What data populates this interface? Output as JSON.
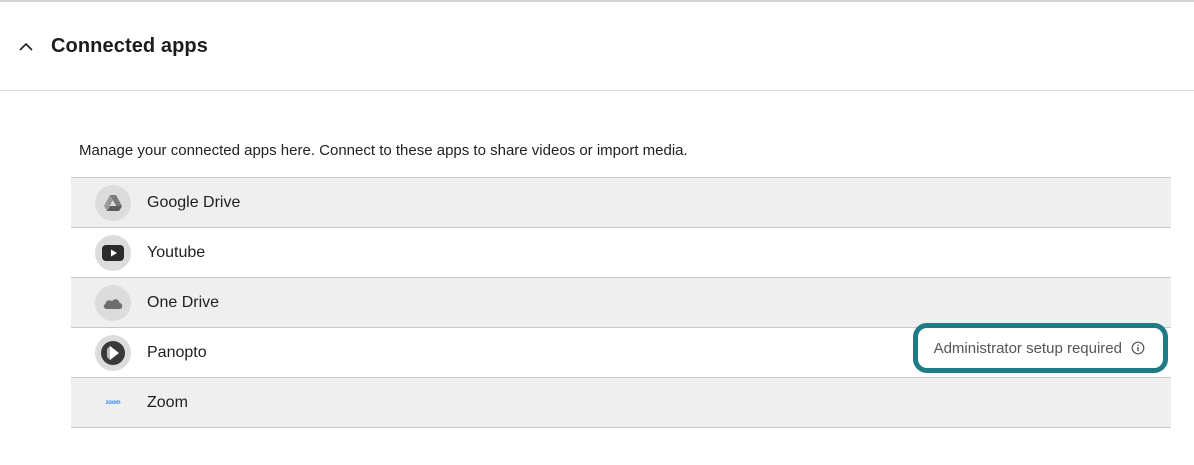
{
  "section": {
    "title": "Connected apps",
    "expanded": true
  },
  "description": "Manage your connected apps here. Connect to these apps to share videos or import media.",
  "apps": [
    {
      "name": "Google Drive",
      "icon": "google-drive-icon"
    },
    {
      "name": "Youtube",
      "icon": "youtube-icon"
    },
    {
      "name": "One Drive",
      "icon": "onedrive-icon"
    },
    {
      "name": "Panopto",
      "icon": "panopto-icon",
      "status": "Administrator setup required",
      "status_icon": "info-icon"
    },
    {
      "name": "Zoom",
      "icon": "zoom-icon",
      "icon_text": "zoom"
    }
  ],
  "colors": {
    "highlight_border": "#1e7b86",
    "row_shaded": "#efefef",
    "zoom_blue": "#2d8cff"
  }
}
